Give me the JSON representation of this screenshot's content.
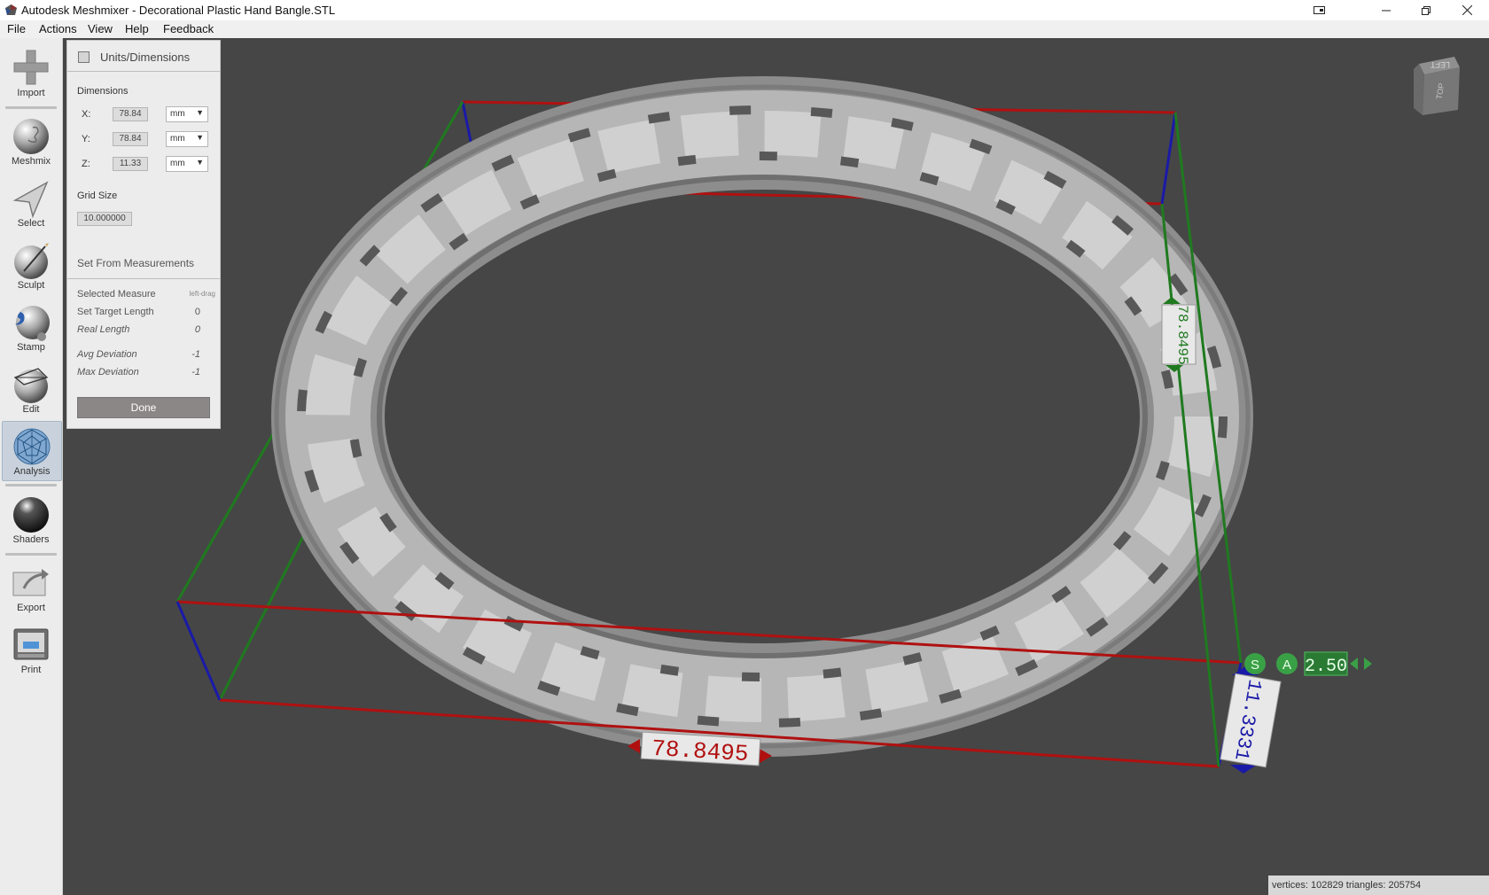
{
  "window": {
    "title": "Autodesk Meshmixer - Decorational Plastic Hand Bangle.STL",
    "controls": [
      "snapshot-icon",
      "minimize-icon",
      "restore-icon",
      "close-icon"
    ]
  },
  "menu": [
    "File",
    "Actions",
    "View",
    "Help",
    "Feedback"
  ],
  "toolbar": {
    "tools": [
      {
        "label": "Import",
        "icon": "plus-icon"
      },
      {
        "label": "Meshmix",
        "icon": "bunny-sphere-icon"
      },
      {
        "label": "Select",
        "icon": "cursor-arrow-icon"
      },
      {
        "label": "Sculpt",
        "icon": "brush-sphere-icon"
      },
      {
        "label": "Stamp",
        "icon": "stamp-sphere-icon"
      },
      {
        "label": "Edit",
        "icon": "edit-sphere-icon"
      },
      {
        "label": "Analysis",
        "icon": "analysis-sphere-icon",
        "active": true
      },
      {
        "label": "Shaders",
        "icon": "shader-sphere-icon"
      },
      {
        "label": "Export",
        "icon": "export-tray-icon"
      },
      {
        "label": "Print",
        "icon": "printer-icon"
      }
    ]
  },
  "panel": {
    "title": "Units/Dimensions",
    "dimensions_label": "Dimensions",
    "dims": [
      {
        "axis": "X:",
        "value": "78.84",
        "unit": "mm"
      },
      {
        "axis": "Y:",
        "value": "78.84",
        "unit": "mm"
      },
      {
        "axis": "Z:",
        "value": "11.33",
        "unit": "mm"
      }
    ],
    "grid_size_label": "Grid Size",
    "grid_size_value": "10.000000",
    "section_title": "Set From Measurements",
    "measurements": {
      "selected_measure_label": "Selected Measure",
      "selected_measure_value": "left-drag",
      "set_target_length_label": "Set Target Length",
      "set_target_length_value": "0",
      "real_length_label": "Real Length",
      "real_length_value": "0",
      "avg_deviation_label": "Avg Deviation",
      "avg_deviation_value": "-1",
      "max_deviation_label": "Max Deviation",
      "max_deviation_value": "-1"
    },
    "done_label": "Done"
  },
  "viewport": {
    "background": "#464646",
    "bbox_labels": {
      "x_length": "78.8495",
      "y_length": "78.8495",
      "z_length": "11.3331"
    },
    "badges": {
      "s": "S",
      "a": "A"
    },
    "step_value": "2.50",
    "navcube": {
      "face_left": "LEFT",
      "face_top": "TOP"
    },
    "colors": {
      "x_axis": "#b01010",
      "y_axis": "#1f7a1f",
      "z_axis": "#1a1aa8",
      "badge": "#3aa046"
    }
  },
  "status": {
    "text": "vertices: 102829 triangles: 205754"
  }
}
